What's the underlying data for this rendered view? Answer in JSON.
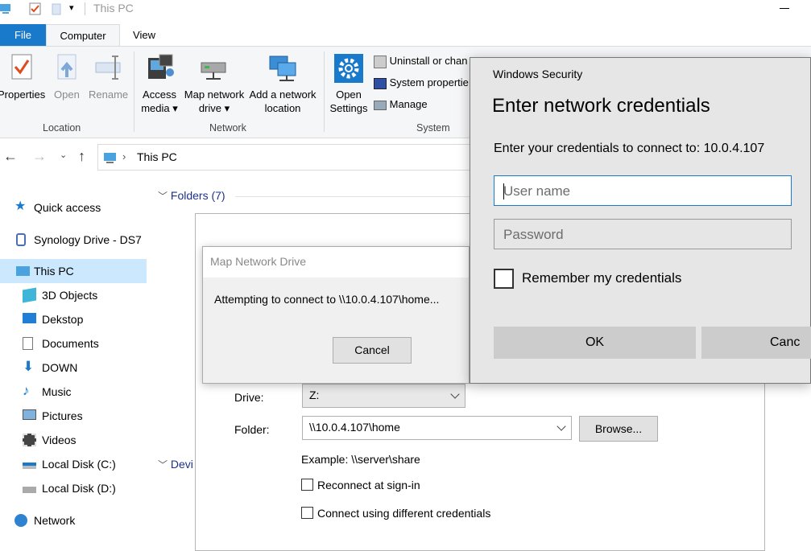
{
  "window": {
    "title": "This PC"
  },
  "ribbon": {
    "tabs": [
      "File",
      "Computer",
      "View"
    ],
    "location": {
      "label": "Location",
      "properties": "Properties",
      "open": "Open",
      "rename": "Rename"
    },
    "network": {
      "label": "Network",
      "access_media": [
        "Access",
        "media"
      ],
      "map_drive": [
        "Map network",
        "drive"
      ],
      "add_location": [
        "Add a network",
        "location"
      ]
    },
    "system": {
      "label": "System",
      "open_settings": [
        "Open",
        "Settings"
      ],
      "uninstall": "Uninstall or chan",
      "system_props": "System propertie",
      "manage": "Manage"
    }
  },
  "address": {
    "path": "This PC"
  },
  "nav": {
    "items": [
      {
        "label": "Quick access",
        "icon": "star-icon"
      },
      {
        "label": "Synology Drive - DS7",
        "icon": "synology-icon"
      },
      {
        "label": "This PC",
        "icon": "computer-icon"
      },
      {
        "label": "3D Objects",
        "icon": "cube-icon"
      },
      {
        "label": "Dekstop",
        "icon": "desktop-icon"
      },
      {
        "label": "Documents",
        "icon": "document-icon"
      },
      {
        "label": "DOWN",
        "icon": "download-icon"
      },
      {
        "label": "Music",
        "icon": "music-icon"
      },
      {
        "label": "Pictures",
        "icon": "pictures-icon"
      },
      {
        "label": "Videos",
        "icon": "videos-icon"
      },
      {
        "label": "Local Disk (C:)",
        "icon": "drive-c-icon"
      },
      {
        "label": "Local Disk (D:)",
        "icon": "drive-d-icon"
      },
      {
        "label": "Network",
        "icon": "network-icon"
      }
    ]
  },
  "content": {
    "folders_header": "Folders (7)",
    "devices_header": "Devi"
  },
  "map_dialog": {
    "drive_label": "Drive:",
    "drive_value": "Z:",
    "folder_label": "Folder:",
    "folder_value": "\\\\10.0.4.107\\home",
    "browse": "Browse...",
    "example": "Example: \\\\server\\share",
    "reconnect": "Reconnect at sign-in",
    "different_creds": "Connect using different credentials"
  },
  "progress_dialog": {
    "title": "Map Network Drive",
    "message": "Attempting to connect to \\\\10.0.4.107\\home...",
    "cancel": "Cancel"
  },
  "security_dialog": {
    "caption": "Windows Security",
    "heading": "Enter network credentials",
    "prompt": "Enter your credentials to connect to: 10.0.4.107",
    "username_placeholder": "User name",
    "password_placeholder": "Password",
    "remember": "Remember my credentials",
    "ok": "OK",
    "cancel": "Canc"
  }
}
